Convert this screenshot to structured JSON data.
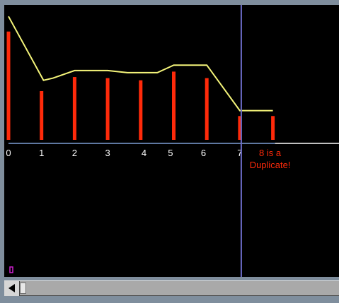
{
  "chart_data": {
    "type": "bar",
    "categories": [
      "0",
      "1",
      "2",
      "3",
      "4",
      "5",
      "6",
      "7",
      "8"
    ],
    "values": [
      100,
      45,
      58,
      57,
      55,
      63,
      57,
      22,
      22
    ],
    "line_values": [
      114,
      55,
      64,
      64,
      62,
      69,
      69,
      27,
      27
    ],
    "ylim": [
      0,
      120
    ],
    "xlim": [
      0,
      10
    ],
    "cursor_x": 7,
    "duplicate_index": 8,
    "annotation": "8 is a\nDuplicate!",
    "annotation_lines": [
      "8 is a",
      "Duplicate!"
    ],
    "colors": {
      "bars": "#ff2a0a",
      "line": "#f5f57a",
      "axis": "#7fa0d8",
      "baseline_tail": "#ffffff",
      "cursor": "#6c6cc8",
      "marker": "#d020d0",
      "background": "#000000"
    }
  },
  "scrollbar": {
    "left_arrow_icon": "triangle-left-icon"
  }
}
